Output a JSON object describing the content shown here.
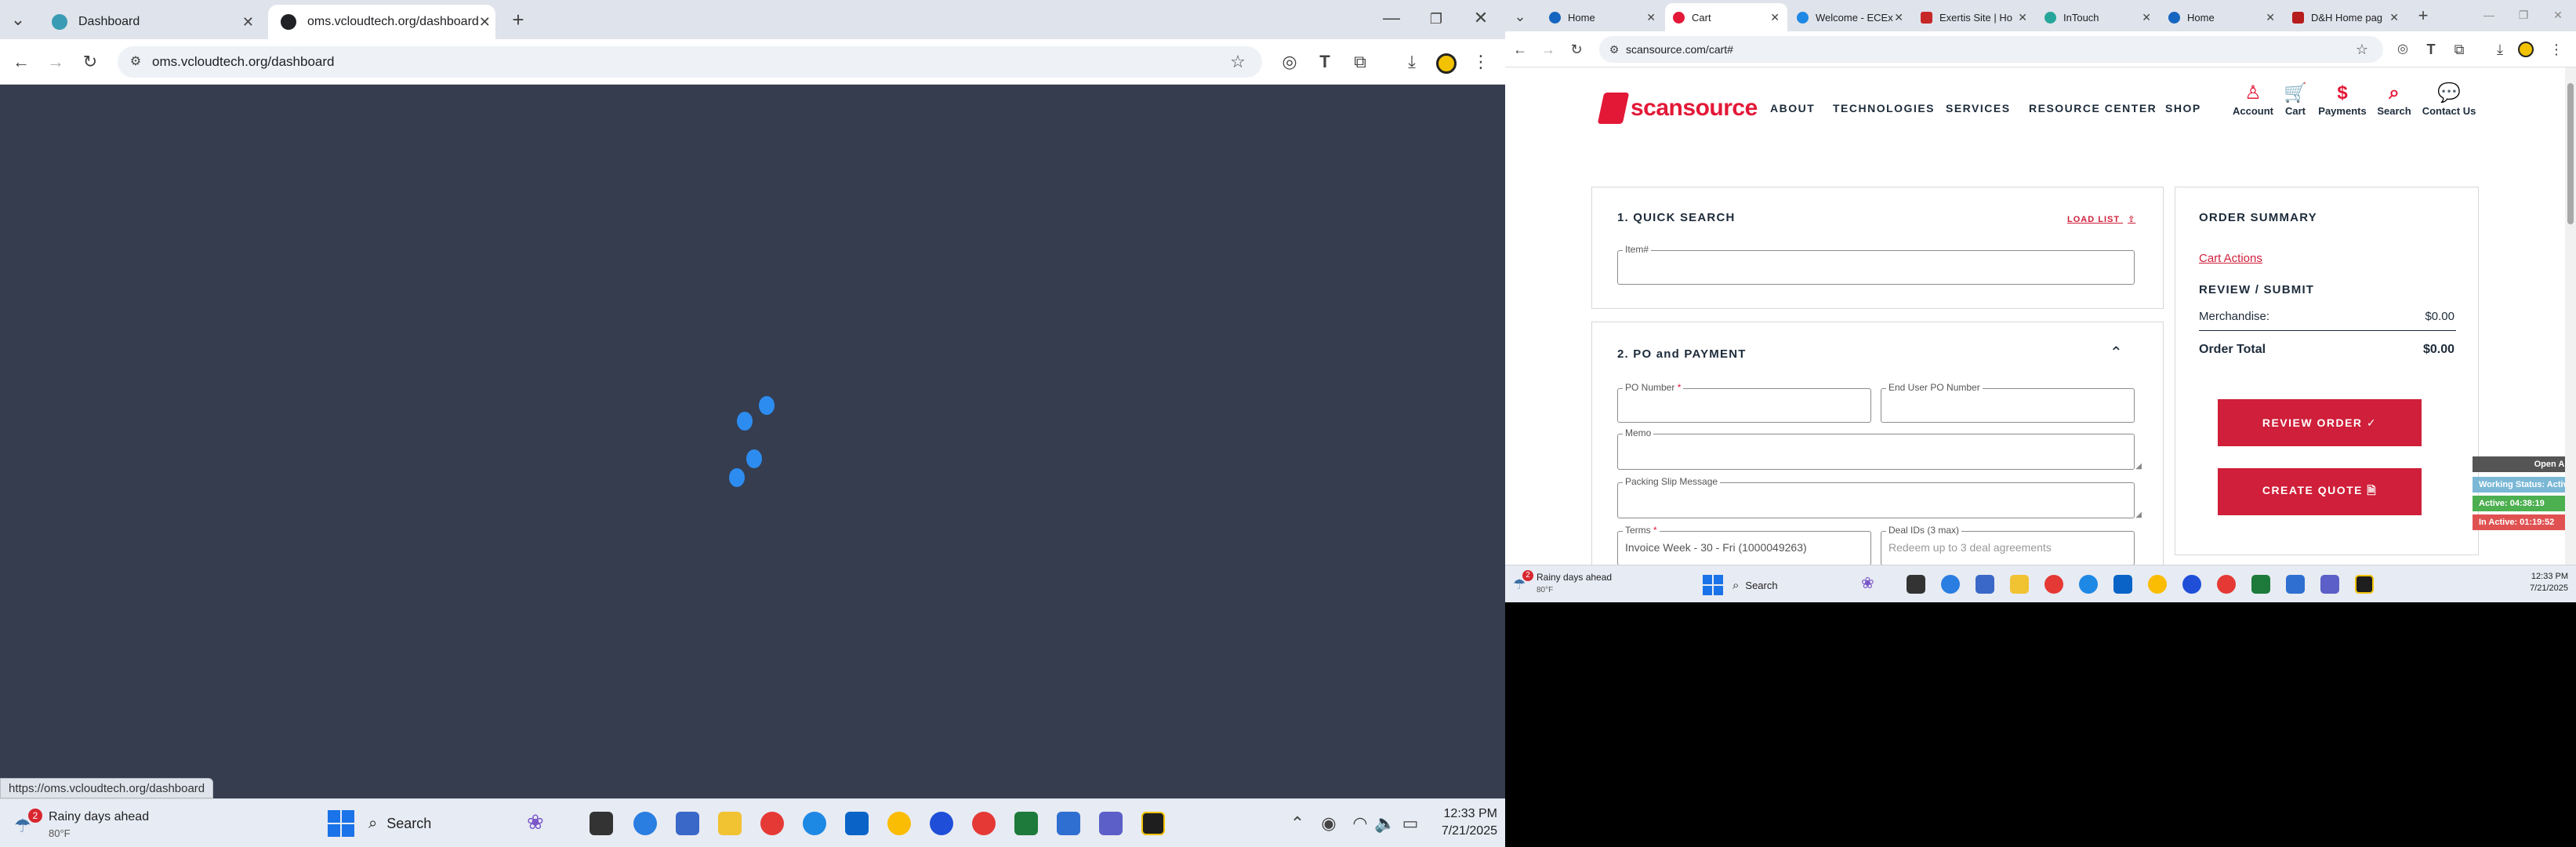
{
  "left": {
    "tabs": [
      {
        "label": "Dashboard",
        "active": false
      },
      {
        "label": "oms.vcloudtech.org/dashboard",
        "active": true
      }
    ],
    "address": "oms.vcloudtech.org/dashboard",
    "status_url": "https://oms.vcloudtech.org/dashboard",
    "weather": {
      "title": "Rainy days ahead",
      "temp": "80°F",
      "badge": "2"
    },
    "search_placeholder": "Search",
    "clock": {
      "time": "12:33 PM",
      "date": "7/21/2025"
    },
    "colors": {
      "page_bg": "#353d4f",
      "spinner": "#2d8cf0"
    }
  },
  "right": {
    "tabs": [
      {
        "label": "Home",
        "active": false
      },
      {
        "label": "Cart",
        "active": true
      },
      {
        "label": "Welcome - ECEx",
        "active": false
      },
      {
        "label": "Exertis Site | Ho",
        "active": false
      },
      {
        "label": "InTouch",
        "active": false
      },
      {
        "label": "Home",
        "active": false
      },
      {
        "label": "D&H Home pag",
        "active": false
      }
    ],
    "address": "scansource.com/cart#",
    "logo": {
      "scan": "scan",
      "source": "source"
    },
    "nav": [
      "ABOUT",
      "TECHNOLOGIES",
      "SERVICES",
      "RESOURCE CENTER",
      "SHOP"
    ],
    "utility": [
      "Account",
      "Cart",
      "Payments",
      "Search",
      "Contact Us"
    ],
    "quick_search": {
      "title": "1. QUICK SEARCH",
      "load_list": "LOAD LIST",
      "item_label": "Item#"
    },
    "po_payment": {
      "title": "2. PO and PAYMENT",
      "po_number_label": "PO Number",
      "end_user_po_label": "End User PO Number",
      "memo_label": "Memo",
      "packing_slip_label": "Packing Slip Message",
      "terms_label": "Terms",
      "terms_value": "Invoice Week - 30 - Fri (1000049263)",
      "deal_ids_label": "Deal IDs (3 max)",
      "deal_ids_placeholder": "Redeem up to 3 deal agreements"
    },
    "order_summary": {
      "title": "ORDER SUMMARY",
      "cart_actions": "Cart Actions",
      "review_title": "REVIEW / SUBMIT",
      "merch_label": "Merchandise:",
      "merch_value": "$0.00",
      "total_label": "Order Total",
      "total_value": "$0.00",
      "review_btn": "REVIEW ORDER ✓",
      "quote_btn": "CREATE QUOTE 🗎"
    },
    "side_widget": {
      "open": "Open Ap",
      "working": "Working Status: Activ",
      "active": "Active: 04:38:19",
      "inactive": "In Active: 01:19:52"
    },
    "weather": {
      "title": "Rainy days ahead",
      "temp": "80°F",
      "badge": "2"
    },
    "search_placeholder": "Search",
    "clock": {
      "time": "12:33 PM",
      "date": "7/21/2025"
    },
    "colors": {
      "brand_red": "#e31837",
      "button_red": "#cf1f3a",
      "navy": "#1d2b3a"
    }
  }
}
